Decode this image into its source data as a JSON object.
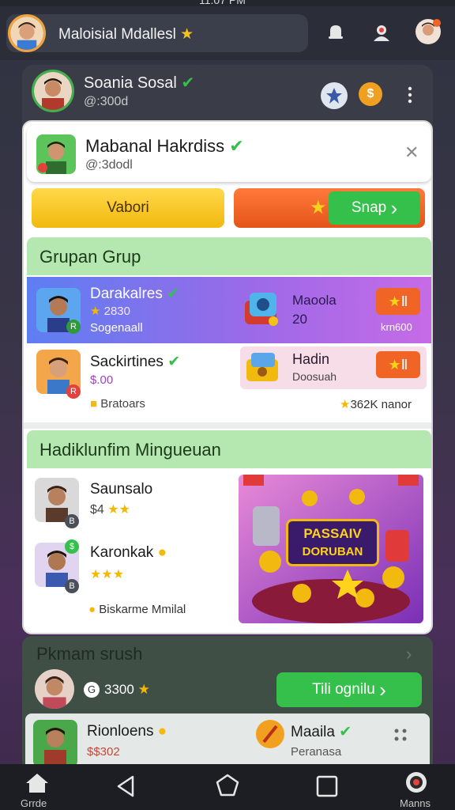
{
  "status_bar": {
    "time": "11:07 PM"
  },
  "top_bar": {
    "profile_name": "Maloisial Mdallesl",
    "verified_star": "★"
  },
  "friend_card": {
    "name": "Soania Sosal",
    "handle": "@:300d"
  },
  "sheet_header": {
    "name": "Mabanal Hakrdiss",
    "handle": "@:3dodl",
    "close": "✕"
  },
  "actions": {
    "left_button": "Vabori",
    "right_button": "Snap",
    "right_arrow": "›"
  },
  "section1": {
    "title": "Grupan Grup",
    "rows": [
      {
        "name": "Darakalres",
        "meta": "2830",
        "sub": "Sogenaall",
        "item_title": "Maoola",
        "item_value": "20",
        "item_meta": "krn600",
        "badge": "R"
      },
      {
        "name": "Sackirtines",
        "meta": "$.00",
        "sub": "Bratoars",
        "item_title": "Hadin",
        "item_value": "Doosuah",
        "item_meta": "362K nanor",
        "badge": "R"
      }
    ]
  },
  "section2": {
    "title": "Hadiklunfim Mingueuan",
    "rows": [
      {
        "name": "Saunsalo",
        "meta": "$4"
      },
      {
        "name": "Karonkak",
        "meta": ""
      }
    ],
    "footer": "Biskarme Mmilal",
    "promo": {
      "line1": "PASSAIV",
      "line2": "DORUBAN"
    }
  },
  "bottom_card": {
    "title": "Pkmam srush",
    "coins": "3300",
    "coin_symbol": "G",
    "button": "Tili ognilu",
    "arrow": "›",
    "row": {
      "name": "Rionloens",
      "meta": "$$302",
      "right_title": "Maaila",
      "right_meta": "Peranasa"
    }
  },
  "nav": {
    "home_label": "Grrde",
    "menu_label": "Manns"
  },
  "colors": {
    "accent_green": "#34c04a",
    "accent_orange": "#f06425",
    "accent_yellow": "#f7c21c",
    "section_green": "#b5e8b0"
  },
  "icons": [
    "bell-icon",
    "alert-icon",
    "avatar-icon",
    "close-icon",
    "more-icon",
    "back-icon",
    "home-icon",
    "recent-icon"
  ]
}
